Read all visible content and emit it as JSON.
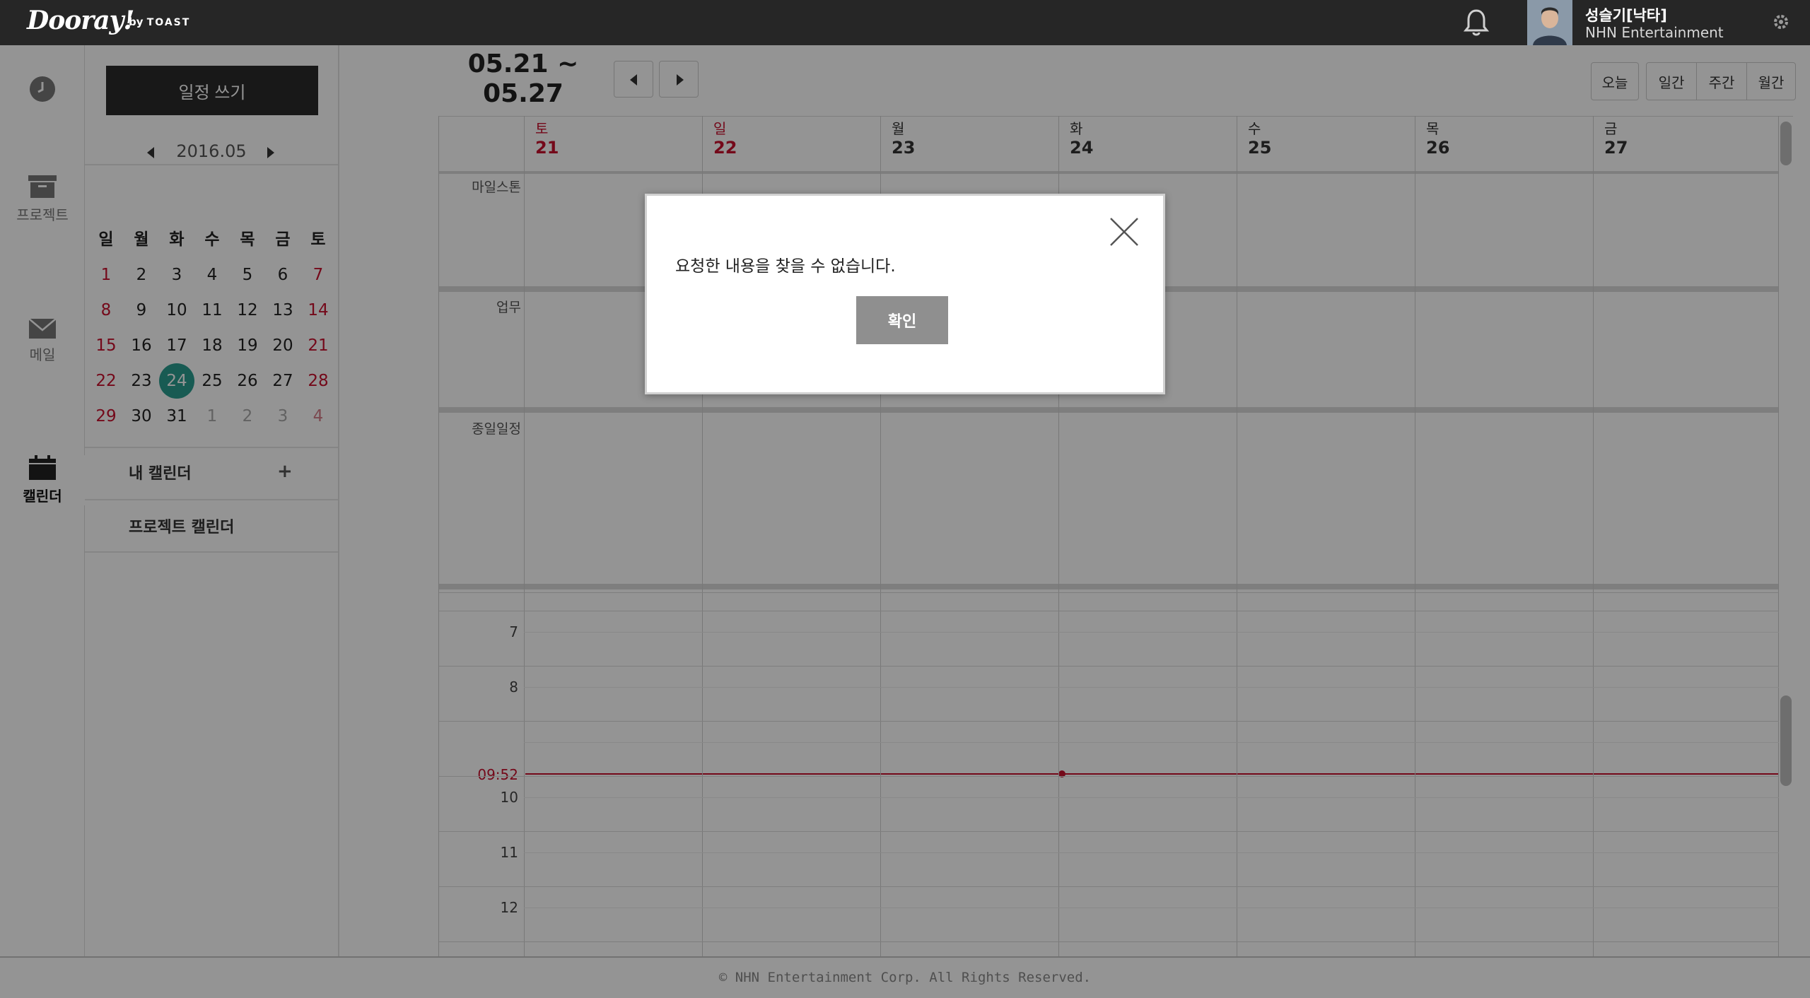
{
  "app": {
    "logo": "Dooray!",
    "logo_by": "by",
    "logo_brand": "TOAST"
  },
  "user": {
    "name": "성슬기[낙타]",
    "org": "NHN Entertainment"
  },
  "nav": {
    "items": [
      {
        "label": "",
        "icon": "clock-icon"
      },
      {
        "label": "프로젝트",
        "icon": "archive-box-icon"
      },
      {
        "label": "메일",
        "icon": "envelope-icon"
      },
      {
        "label": "캘린더",
        "icon": "calendar-icon",
        "active": true
      }
    ]
  },
  "sidebar": {
    "write_button": "일정 쓰기",
    "mini_cal": {
      "month_label": "2016.05",
      "weekdays": [
        "일",
        "월",
        "화",
        "수",
        "목",
        "금",
        "토"
      ],
      "weeks": [
        [
          "1",
          "2",
          "3",
          "4",
          "5",
          "6",
          "7"
        ],
        [
          "8",
          "9",
          "10",
          "11",
          "12",
          "13",
          "14"
        ],
        [
          "15",
          "16",
          "17",
          "18",
          "19",
          "20",
          "21"
        ],
        [
          "22",
          "23",
          "24",
          "25",
          "26",
          "27",
          "28"
        ],
        [
          "29",
          "30",
          "31",
          "1",
          "2",
          "3",
          "4"
        ]
      ],
      "today": "24"
    },
    "my_calendar": "내 캘린더",
    "add_icon": "+",
    "project_calendar": "프로젝트 캘린더"
  },
  "toolbar": {
    "range_start": "05.21 ~",
    "range_end": "05.27",
    "views": [
      "오늘",
      "일간",
      "주간",
      "월간"
    ]
  },
  "week": {
    "days": [
      {
        "dow": "토",
        "date": "21",
        "red": true
      },
      {
        "dow": "일",
        "date": "22",
        "red": true
      },
      {
        "dow": "월",
        "date": "23",
        "red": false
      },
      {
        "dow": "화",
        "date": "24",
        "red": false
      },
      {
        "dow": "수",
        "date": "25",
        "red": false
      },
      {
        "dow": "목",
        "date": "26",
        "red": false
      },
      {
        "dow": "금",
        "date": "27",
        "red": false
      }
    ],
    "rows": {
      "milestone": "마일스톤",
      "task": "업무",
      "allday": "종일일정"
    },
    "hours": [
      "7",
      "8",
      "10",
      "11",
      "12"
    ],
    "now_time": "09:52"
  },
  "footer": "© NHN Entertainment Corp. All Rights Reserved.",
  "dialog": {
    "message": "요청한 내용을 찾을 수 없습니다.",
    "ok_label": "확인"
  },
  "colors": {
    "accent_red": "#c8102e",
    "today_teal": "#2a9d8f",
    "topbar": "#262626"
  }
}
